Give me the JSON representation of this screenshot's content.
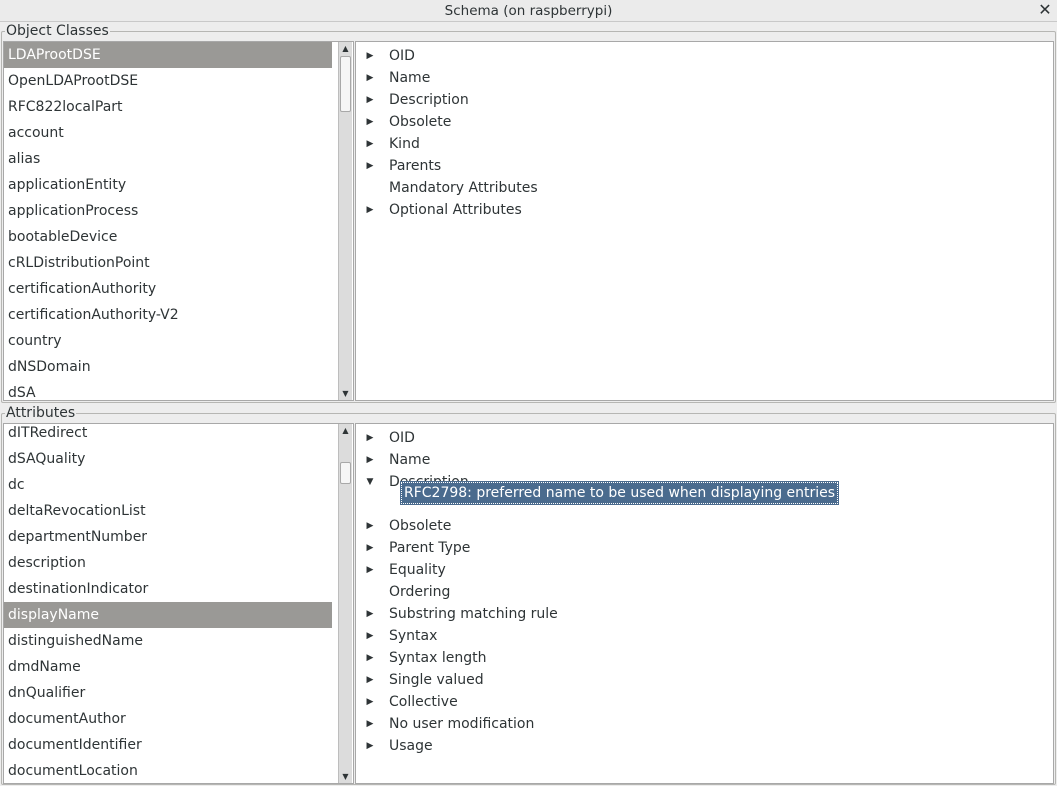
{
  "window": {
    "title": "Schema (on raspberrypi)",
    "close_glyph": "✕"
  },
  "object_classes": {
    "label": "Object Classes",
    "items": [
      "LDAProotDSE",
      "OpenLDAProotDSE",
      "RFC822localPart",
      "account",
      "alias",
      "applicationEntity",
      "applicationProcess",
      "bootableDevice",
      "cRLDistributionPoint",
      "certificationAuthority",
      "certificationAuthority-V2",
      "country",
      "dNSDomain",
      "dSA"
    ],
    "selected_item": "LDAProotDSE",
    "details": [
      {
        "label": "OID",
        "expander": "collapsed"
      },
      {
        "label": "Name",
        "expander": "collapsed"
      },
      {
        "label": "Description",
        "expander": "collapsed"
      },
      {
        "label": "Obsolete",
        "expander": "collapsed"
      },
      {
        "label": "Kind",
        "expander": "collapsed"
      },
      {
        "label": "Parents",
        "expander": "collapsed"
      },
      {
        "label": "Mandatory Attributes",
        "expander": "none"
      },
      {
        "label": "Optional Attributes",
        "expander": "collapsed"
      }
    ]
  },
  "attributes": {
    "label": "Attributes",
    "items": [
      "dITRedirect",
      "dSAQuality",
      "dc",
      "deltaRevocationList",
      "departmentNumber",
      "description",
      "destinationIndicator",
      "displayName",
      "distinguishedName",
      "dmdName",
      "dnQualifier",
      "documentAuthor",
      "documentIdentifier",
      "documentLocation"
    ],
    "selected_item": "displayName",
    "details": [
      {
        "label": "OID",
        "expander": "collapsed"
      },
      {
        "label": "Name",
        "expander": "collapsed"
      },
      {
        "label": "Description",
        "expander": "expanded"
      },
      {
        "label": "Obsolete",
        "expander": "collapsed"
      },
      {
        "label": "Parent Type",
        "expander": "collapsed"
      },
      {
        "label": "Equality",
        "expander": "collapsed"
      },
      {
        "label": "Ordering",
        "expander": "none"
      },
      {
        "label": "Substring matching rule",
        "expander": "collapsed"
      },
      {
        "label": "Syntax",
        "expander": "collapsed"
      },
      {
        "label": "Syntax length",
        "expander": "collapsed"
      },
      {
        "label": "Single valued",
        "expander": "collapsed"
      },
      {
        "label": "Collective",
        "expander": "collapsed"
      },
      {
        "label": "No user modification",
        "expander": "collapsed"
      },
      {
        "label": "Usage",
        "expander": "collapsed"
      }
    ],
    "description_value": "RFC2798: preferred name to be used when displaying entries"
  },
  "icons": {
    "collapsed": "▶",
    "expanded": "▼",
    "scroll_up": "▲",
    "scroll_down": "▼"
  },
  "colors": {
    "selection_gray": "#9a9996",
    "value_highlight": "#4a6b8e"
  }
}
